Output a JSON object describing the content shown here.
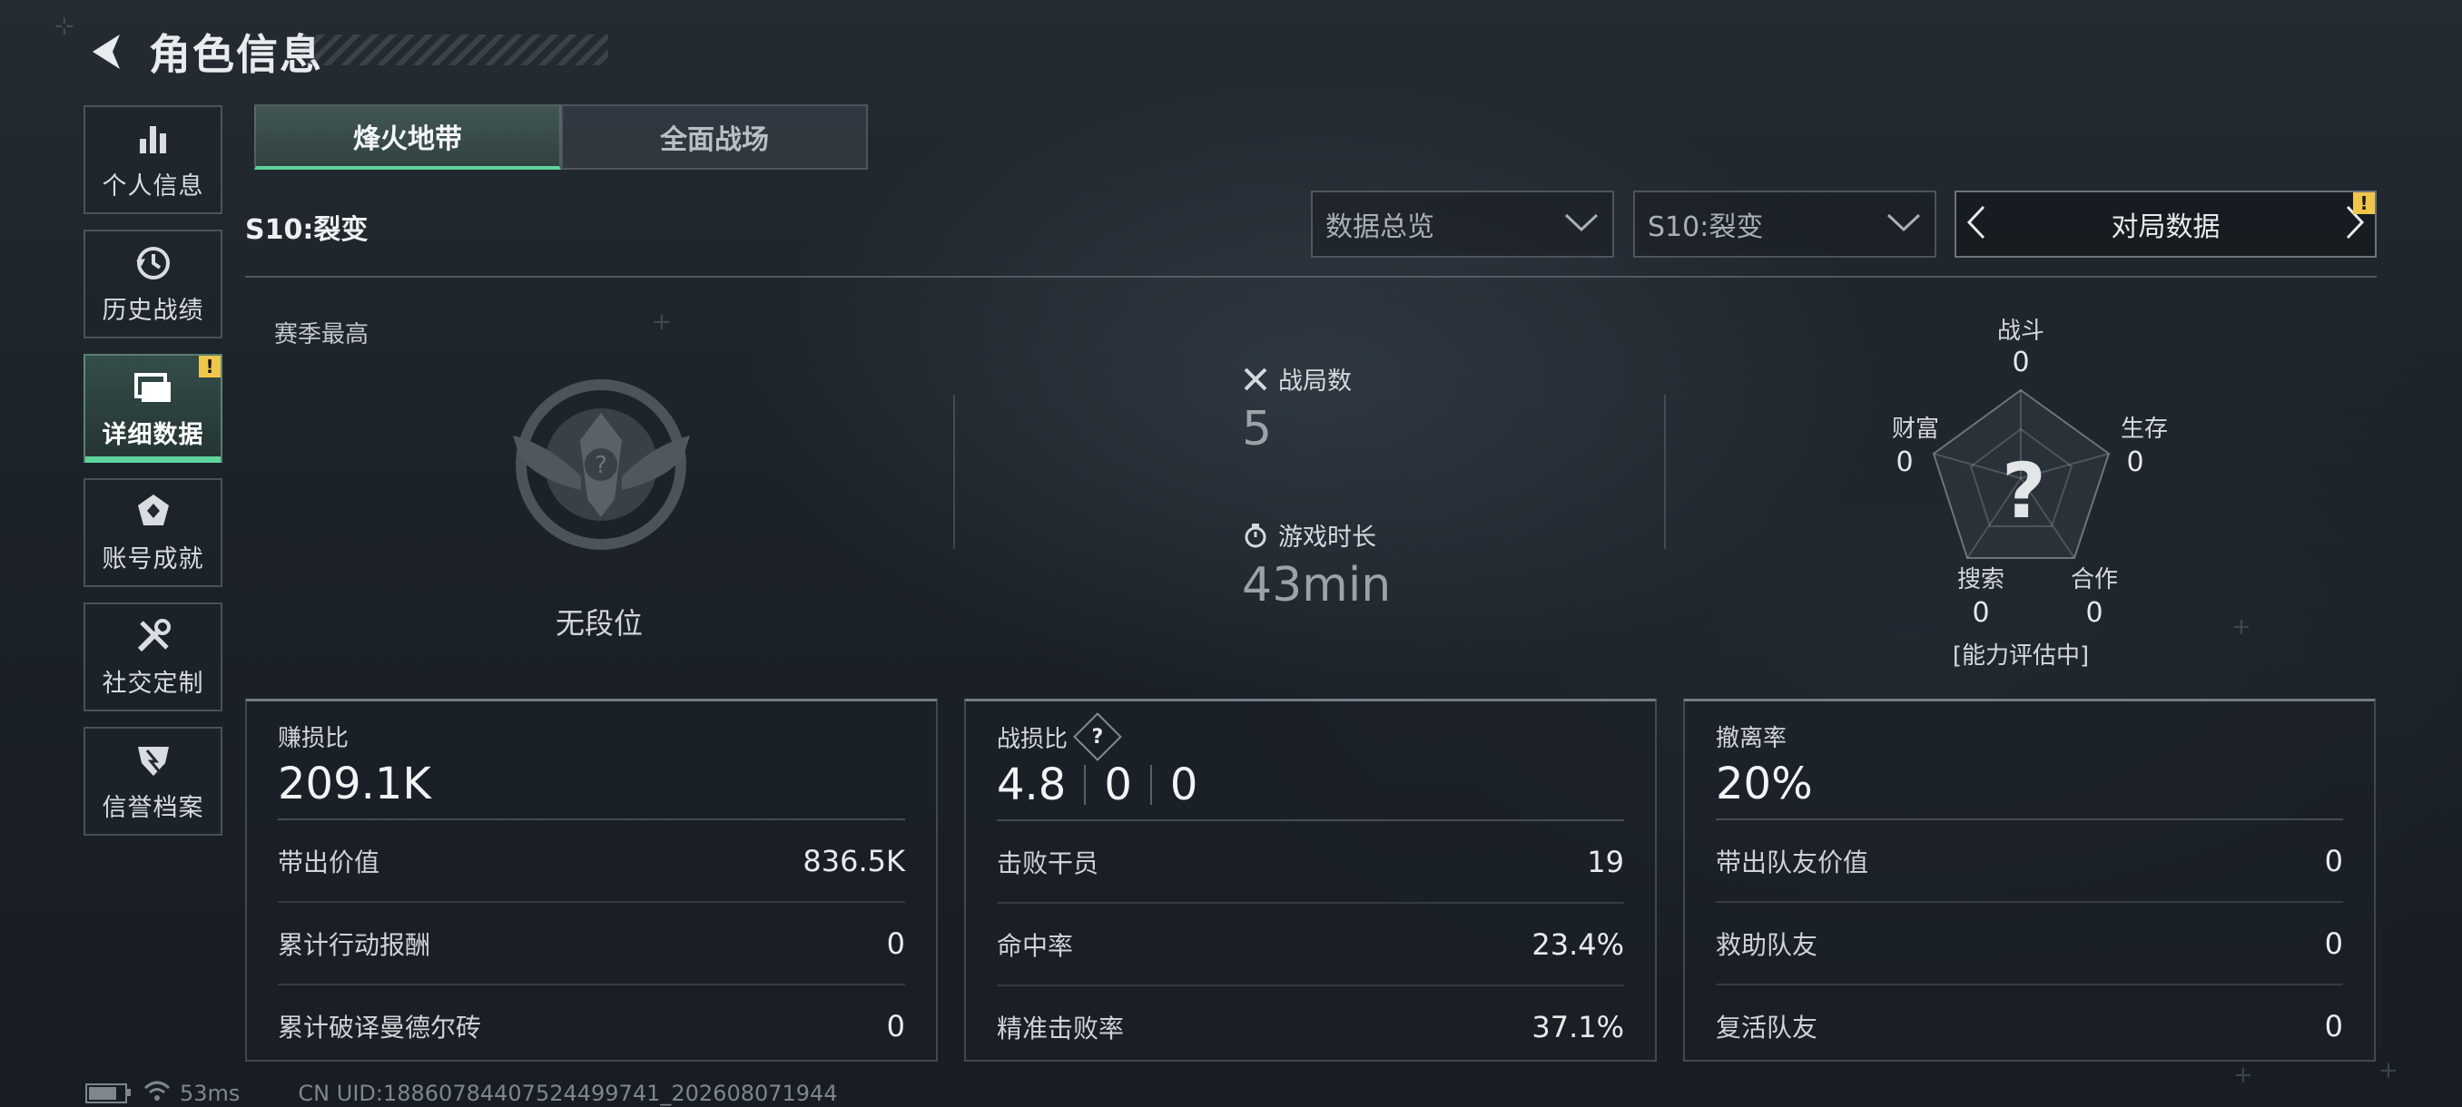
{
  "header": {
    "title": "角色信息"
  },
  "sidebar": {
    "items": [
      {
        "label": "个人信息",
        "icon": "bar-chart-icon"
      },
      {
        "label": "历史战绩",
        "icon": "history-icon"
      },
      {
        "label": "详细数据",
        "icon": "folder-icon",
        "active": true,
        "badge": "!"
      },
      {
        "label": "账号成就",
        "icon": "achievement-icon"
      },
      {
        "label": "社交定制",
        "icon": "tools-icon"
      },
      {
        "label": "信誉档案",
        "icon": "shield-icon"
      }
    ]
  },
  "tabs": [
    {
      "label": "烽火地带",
      "active": true
    },
    {
      "label": "全面战场",
      "active": false
    }
  ],
  "season_label": "S10:裂变",
  "filters": {
    "overview": "数据总览",
    "season": "S10:裂变",
    "match_data": "对局数据",
    "match_badge": "!"
  },
  "overview": {
    "season_best_label": "赛季最高",
    "rank_text": "无段位",
    "matches": {
      "label": "战局数",
      "value": "5"
    },
    "playtime": {
      "label": "游戏时长",
      "value": "43min"
    }
  },
  "radar": {
    "axes": [
      {
        "label": "战斗",
        "value": "0"
      },
      {
        "label": "生存",
        "value": "0"
      },
      {
        "label": "合作",
        "value": "0"
      },
      {
        "label": "搜索",
        "value": "0"
      },
      {
        "label": "财富",
        "value": "0"
      }
    ],
    "center": "?",
    "status": "[能力评估中]"
  },
  "panels": {
    "profit": {
      "title": "赚损比",
      "big": "209.1K",
      "rows": [
        {
          "k": "带出价值",
          "v": "836.5K"
        },
        {
          "k": "累计行动报酬",
          "v": "0"
        },
        {
          "k": "累计破译曼德尔砖",
          "v": "0"
        }
      ]
    },
    "combat": {
      "title": "战损比",
      "help": "?",
      "big": [
        "4.8",
        "0",
        "0"
      ],
      "rows": [
        {
          "k": "击败干员",
          "v": "19"
        },
        {
          "k": "命中率",
          "v": "23.4%"
        },
        {
          "k": "精准击败率",
          "v": "37.1%"
        }
      ]
    },
    "extract": {
      "title": "撤离率",
      "big": "20%",
      "rows": [
        {
          "k": "带出队友价值",
          "v": "0"
        },
        {
          "k": "救助队友",
          "v": "0"
        },
        {
          "k": "复活队友",
          "v": "0"
        }
      ]
    }
  },
  "footer": {
    "ping": "53ms",
    "uid": "CN UID:1886078440752449974​1_202608071944"
  },
  "colors": {
    "accent": "#5fd49d",
    "badge": "#f0c64a"
  }
}
